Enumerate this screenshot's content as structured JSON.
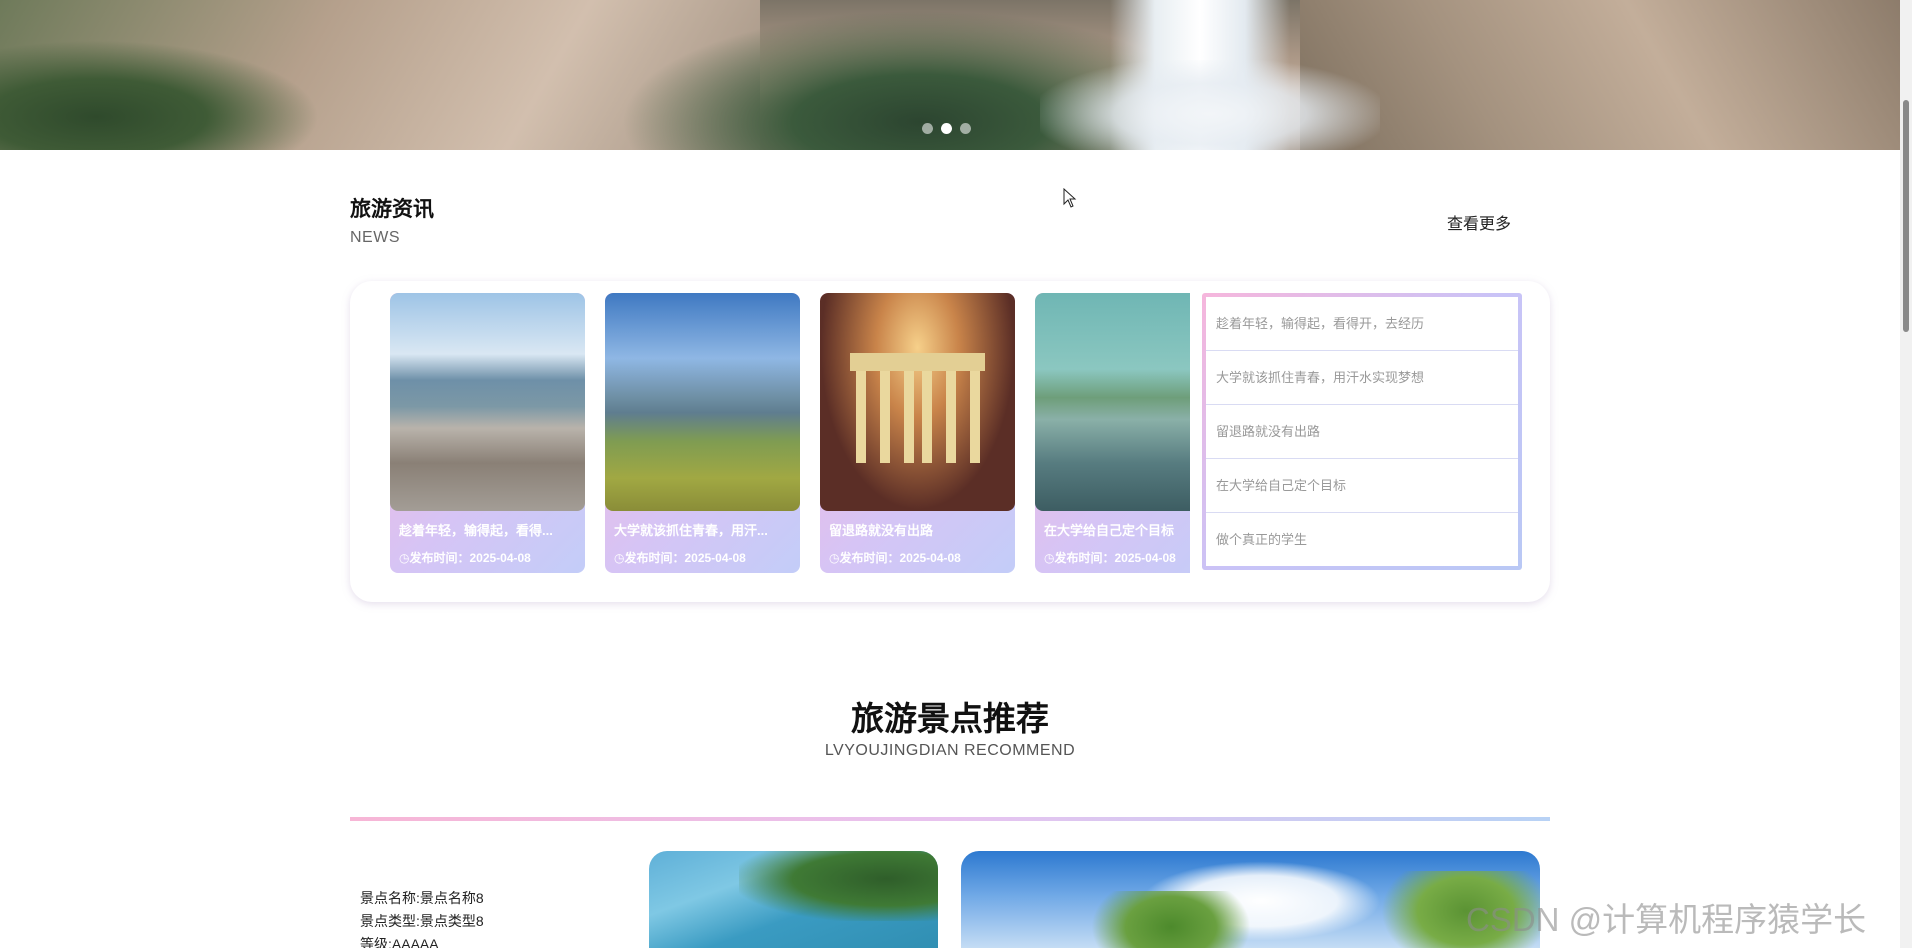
{
  "hero": {
    "dots": [
      {
        "active": false
      },
      {
        "active": true
      },
      {
        "active": false
      }
    ]
  },
  "news": {
    "title": "旅游资讯",
    "subtitle": "NEWS",
    "more_label": "查看更多",
    "cards": [
      {
        "title": "趁着年轻，输得起，看得...",
        "date": "◷发布时间：2025-04-08"
      },
      {
        "title": "大学就该抓住青春，用汗...",
        "date": "◷发布时间：2025-04-08"
      },
      {
        "title": "留退路就没有出路",
        "date": "◷发布时间：2025-04-08"
      },
      {
        "title": "在大学给自己定个目标",
        "date": "◷发布时间：2025-04-08"
      }
    ],
    "list": [
      "趁着年轻，输得起，看得开，去经历",
      "大学就该抓住青春，用汗水实现梦想",
      "留退路就没有出路",
      "在大学给自己定个目标",
      "做个真正的学生"
    ]
  },
  "attractions": {
    "title": "旅游景点推荐",
    "subtitle": "LVYOUJINGDIAN RECOMMEND",
    "spot": {
      "name_line": "景点名称:景点名称8",
      "type_line": "景点类型:景点类型8",
      "level_line": "等级:AAAAA"
    }
  },
  "watermark": "CSDN @计算机程序猿学长",
  "colors": {
    "accent_pink": "#f7b6d6",
    "accent_blue": "#b8d2f5"
  }
}
